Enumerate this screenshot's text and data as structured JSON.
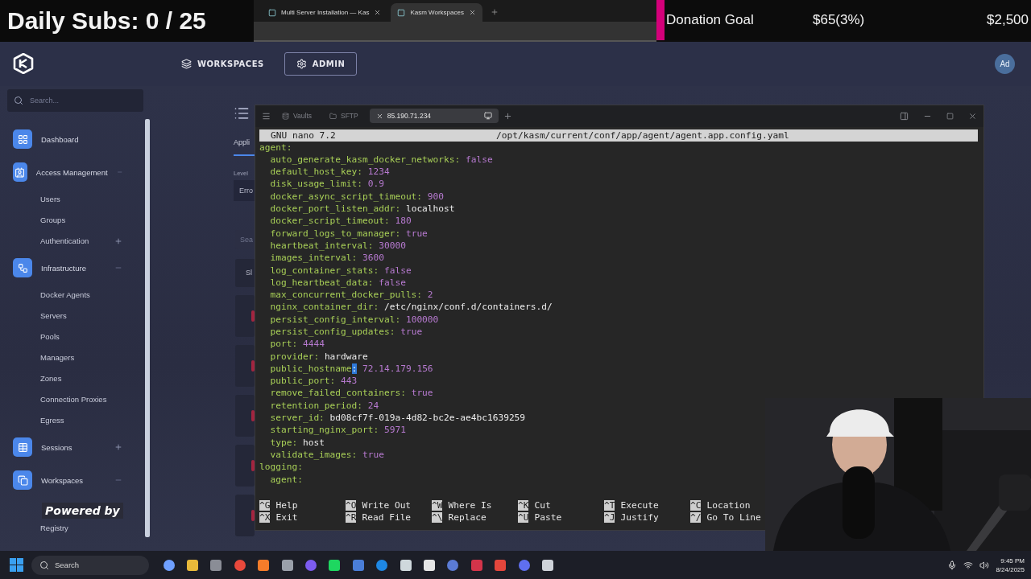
{
  "overlay": {
    "subs_label": "Daily Subs: 0 / 25",
    "donation_label": "Donation Goal",
    "donation_amount": "$65(3%)",
    "donation_target": "$2,500",
    "powered_label": "Powered by"
  },
  "browser_tabs": [
    {
      "title": "Multi Server Installation — Kas",
      "selected": false
    },
    {
      "title": "Kasm Workspaces",
      "selected": true
    }
  ],
  "header": {
    "nav": [
      {
        "label": "WORKSPACES",
        "selected": false
      },
      {
        "label": "ADMIN",
        "selected": true
      }
    ],
    "avatar": "Ad"
  },
  "sidebar": {
    "search_placeholder": "Search...",
    "items": [
      {
        "label": "Dashboard",
        "kind": "section"
      },
      {
        "label": "Access Management",
        "kind": "section",
        "expanded": true,
        "children": [
          {
            "label": "Users"
          },
          {
            "label": "Groups"
          },
          {
            "label": "Authentication",
            "expanded": false
          }
        ]
      },
      {
        "label": "Infrastructure",
        "kind": "section",
        "expanded": true,
        "children": [
          {
            "label": "Docker Agents"
          },
          {
            "label": "Servers"
          },
          {
            "label": "Pools"
          },
          {
            "label": "Managers"
          },
          {
            "label": "Zones"
          },
          {
            "label": "Connection Proxies"
          },
          {
            "label": "Egress"
          }
        ]
      },
      {
        "label": "Sessions",
        "kind": "section",
        "expanded": false
      },
      {
        "label": "Workspaces",
        "kind": "section",
        "expanded": true,
        "children": [
          {
            "label": "Registry"
          }
        ]
      }
    ]
  },
  "main_panel": {
    "tab": "Appli",
    "level_label": "Level",
    "level_value": "Erro",
    "search_placeholder": "Sea",
    "button": "Sl"
  },
  "terminal": {
    "tabs": [
      {
        "label": "Vaults",
        "selected": false
      },
      {
        "label": "SFTP",
        "selected": false
      },
      {
        "label": "85.190.71.234",
        "selected": true
      }
    ]
  },
  "nano": {
    "version": "GNU nano 7.2",
    "path": "/opt/kasm/current/conf/app/agent/agent.app.config.yaml",
    "lines": [
      {
        "key": "agent:",
        "children": [
          {
            "key": "auto_generate_kasm_docker_networks:",
            "value": "false",
            "kind": "literal"
          },
          {
            "key": "default_host_key:",
            "value": "1234",
            "kind": "literal"
          },
          {
            "key": "disk_usage_limit:",
            "value": "0.9",
            "kind": "literal"
          },
          {
            "key": "docker_async_script_timeout:",
            "value": "900",
            "kind": "literal"
          },
          {
            "key": "docker_port_listen_addr:",
            "value": "localhost",
            "kind": "text"
          },
          {
            "key": "docker_script_timeout:",
            "value": "180",
            "kind": "literal"
          },
          {
            "key": "forward_logs_to_manager:",
            "value": "true",
            "kind": "literal"
          },
          {
            "key": "heartbeat_interval:",
            "value": "30000",
            "kind": "literal"
          },
          {
            "key": "images_interval:",
            "value": "3600",
            "kind": "literal"
          },
          {
            "key": "log_container_stats:",
            "value": "false",
            "kind": "literal"
          },
          {
            "key": "log_heartbeat_data:",
            "value": "false",
            "kind": "literal"
          },
          {
            "key": "max_concurrent_docker_pulls:",
            "value": "2",
            "kind": "literal"
          },
          {
            "key": "nginx_container_dir:",
            "value": "/etc/nginx/conf.d/containers.d/",
            "kind": "text"
          },
          {
            "key": "persist_config_interval:",
            "value": "100000",
            "kind": "literal"
          },
          {
            "key": "persist_config_updates:",
            "value": "true",
            "kind": "literal"
          },
          {
            "key": "port:",
            "value": "4444",
            "kind": "literal"
          },
          {
            "key": "provider:",
            "value": "hardware",
            "kind": "text"
          },
          {
            "key": "public_hostname:",
            "value": "72.14.179.156",
            "kind": "literal",
            "cursor": true
          },
          {
            "key": "public_port:",
            "value": "443",
            "kind": "literal"
          },
          {
            "key": "remove_failed_containers:",
            "value": "true",
            "kind": "literal"
          },
          {
            "key": "retention_period:",
            "value": "24",
            "kind": "literal"
          },
          {
            "key": "server_id:",
            "value": "bd08cf7f-019a-4d82-bc2e-ae4bc1639259",
            "kind": "text"
          },
          {
            "key": "starting_nginx_port:",
            "value": "5971",
            "kind": "literal"
          },
          {
            "key": "type:",
            "value": "host",
            "kind": "text"
          },
          {
            "key": "validate_images:",
            "value": "true",
            "kind": "literal"
          }
        ]
      },
      {
        "key": "logging:",
        "children": [
          {
            "key": "agent:"
          }
        ]
      }
    ],
    "shortcuts": [
      [
        {
          "key": "^G",
          "label": "Help"
        },
        {
          "key": "^X",
          "label": "Exit"
        }
      ],
      [
        {
          "key": "^O",
          "label": "Write Out"
        },
        {
          "key": "^R",
          "label": "Read File"
        }
      ],
      [
        {
          "key": "^W",
          "label": "Where Is"
        },
        {
          "key": "^\\",
          "label": "Replace"
        }
      ],
      [
        {
          "key": "^K",
          "label": "Cut"
        },
        {
          "key": "^U",
          "label": "Paste"
        }
      ],
      [
        {
          "key": "^T",
          "label": "Execute"
        },
        {
          "key": "^J",
          "label": "Justify"
        }
      ],
      [
        {
          "key": "^C",
          "label": "Location"
        },
        {
          "key": "^/",
          "label": "Go To Line"
        }
      ]
    ]
  },
  "taskbar": {
    "search": "Search",
    "time": "9:45 PM",
    "date": "8/24/2025"
  }
}
